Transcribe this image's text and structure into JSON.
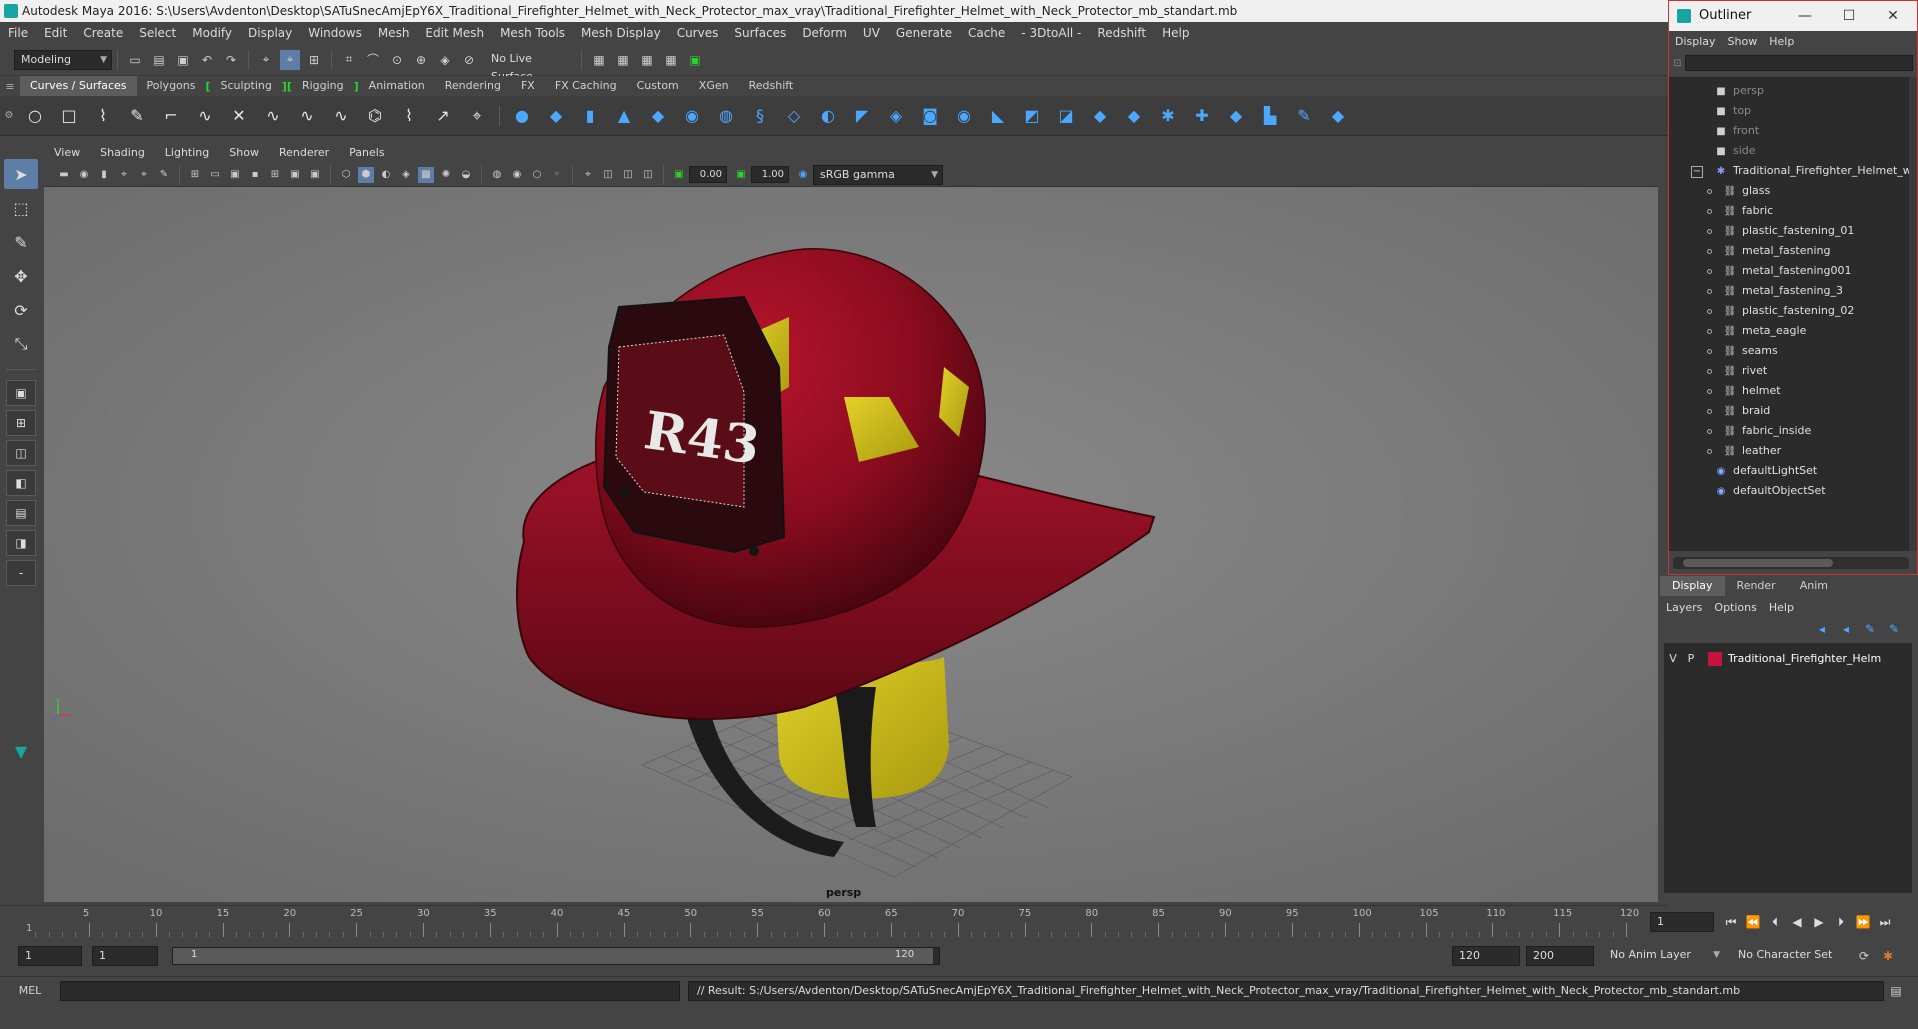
{
  "window": {
    "title": "Autodesk Maya 2016: S:\\Users\\Avdenton\\Desktop\\SATuSnecAmjEpY6X_Traditional_Firefighter_Helmet_with_Neck_Protector_max_vray\\Traditional_Firefighter_Helmet_with_Neck_Protector_mb_standart.mb"
  },
  "menubar": [
    "File",
    "Edit",
    "Create",
    "Select",
    "Modify",
    "Display",
    "Windows",
    "Mesh",
    "Edit Mesh",
    "Mesh Tools",
    "Mesh Display",
    "Curves",
    "Surfaces",
    "Deform",
    "UV",
    "Generate",
    "Cache",
    "- 3DtoAll -",
    "Redshift",
    "Help"
  ],
  "statusline": {
    "mode": "Modeling",
    "live_surface": "No Live Surface"
  },
  "shelf_tabs": [
    "Curves / Surfaces",
    "Polygons",
    "Sculpting",
    "Rigging",
    "Animation",
    "Rendering",
    "FX",
    "FX Caching",
    "Custom",
    "XGen",
    "Redshift"
  ],
  "shelf_active_tab": "Curves / Surfaces",
  "viewport": {
    "menu": [
      "View",
      "Shading",
      "Lighting",
      "Show",
      "Renderer",
      "Panels"
    ],
    "exposure": "0.00",
    "gamma": "1.00",
    "color_space": "sRGB gamma",
    "camera_label": "persp",
    "badge_text": "R43"
  },
  "timeline": {
    "ticks": [
      "5",
      "10",
      "15",
      "20",
      "25",
      "30",
      "35",
      "40",
      "45",
      "50",
      "55",
      "60",
      "65",
      "70",
      "75",
      "80",
      "85",
      "90",
      "95",
      "100",
      "105",
      "110",
      "115",
      "120"
    ],
    "start_marker": "1",
    "current_frame": "1",
    "current_frame_display": "1",
    "range_start": "1",
    "range_start_inner": "1",
    "range_slider_start": "1",
    "range_slider_end": "120",
    "range_end_inner": "120",
    "range_end": "200",
    "anim_layer": "No Anim Layer",
    "character_set": "No Character Set"
  },
  "cmdline": {
    "label": "MEL",
    "result": "// Result: S:/Users/Avdenton/Desktop/SATuSnecAmjEpY6X_Traditional_Firefighter_Helmet_with_Neck_Protector_max_vray/Traditional_Firefighter_Helmet_with_Neck_Protector_mb_standart.mb"
  },
  "outliner": {
    "title": "Outliner",
    "menu": [
      "Display",
      "Show",
      "Help"
    ],
    "cameras": [
      "persp",
      "top",
      "front",
      "side"
    ],
    "root": "Traditional_Firefighter_Helmet_w",
    "children": [
      "glass",
      "fabric",
      "plastic_fastening_01",
      "metal_fastening",
      "metal_fastening001",
      "metal_fastening_3",
      "plastic_fastening_02",
      "meta_eagle",
      "seams",
      "rivet",
      "helmet",
      "braid",
      "fabric_inside",
      "leather"
    ],
    "sets": [
      "defaultLightSet",
      "defaultObjectSet"
    ]
  },
  "layer_editor": {
    "tabs": [
      "Display",
      "Render",
      "Anim"
    ],
    "menu": [
      "Layers",
      "Options",
      "Help"
    ],
    "layer": {
      "v": "V",
      "p": "P",
      "name": "Traditional_Firefighter_Helm",
      "color": "#c8143c"
    }
  }
}
